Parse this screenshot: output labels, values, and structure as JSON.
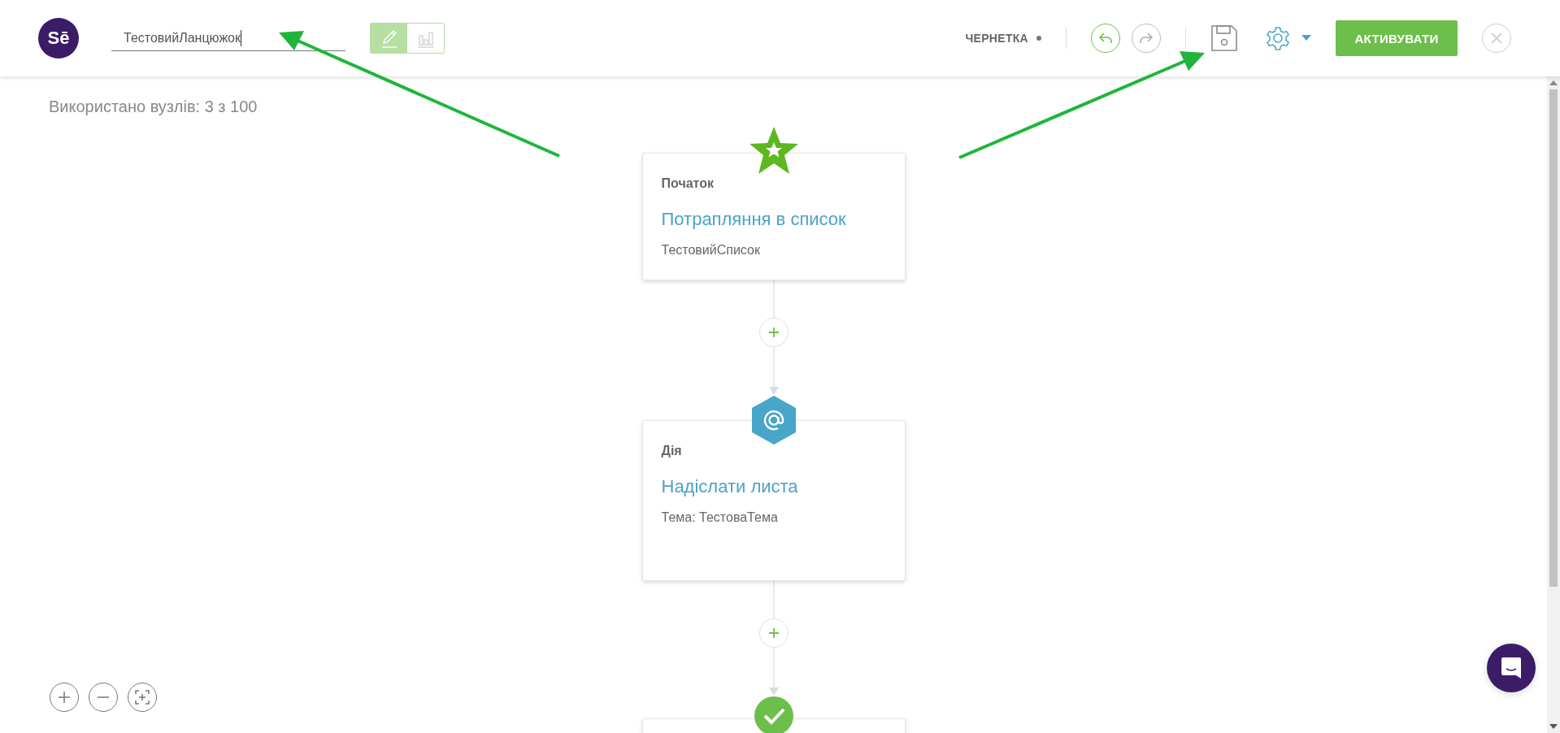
{
  "logo": {
    "text": "Sē"
  },
  "chain_name": {
    "value": "ТестовийЛанцюжок"
  },
  "view_toggle": [
    {
      "kind": "edit",
      "selected": true
    },
    {
      "kind": "stats",
      "selected": false
    }
  ],
  "status": {
    "label": "ЧЕРНЕТКА"
  },
  "history": [
    {
      "kind": "undo",
      "disabled": false
    },
    {
      "kind": "redo",
      "disabled": true
    }
  ],
  "activate_button": {
    "label": "АКТИВУВАТИ"
  },
  "usage": "Використано вузлів: 3 з 100",
  "nodes": [
    {
      "kind": "start",
      "category": "Початок",
      "title": "Потрапляння в список",
      "detail": "ТестовийСписок"
    },
    {
      "kind": "email",
      "category": "Дія",
      "title": "Надіслати листа",
      "detail": "Тема: ТестоваТема"
    },
    {
      "kind": "finish"
    }
  ]
}
